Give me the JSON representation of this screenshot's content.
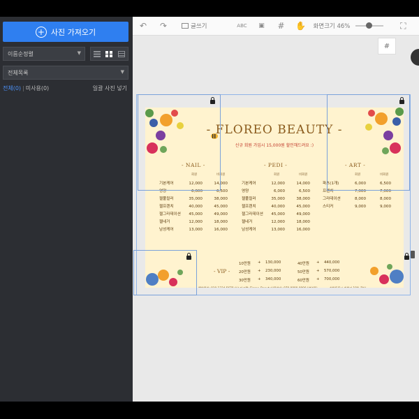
{
  "sidebar": {
    "upload_label": "사진 가져오기",
    "sort_value": "이름순정렬",
    "folder_value": "전체목록",
    "filter_all": "전체(0)",
    "filter_used": "미사용(0)",
    "place_all": "일괄 사진 넣기"
  },
  "toolbar": {
    "write_label": "글쓰기",
    "zoom_label": "화면크기 46%",
    "zoom_value": 0.46
  },
  "card": {
    "title": "- FLOREO BEAUTY -",
    "subtitle": "신규 회원 가입시 15,000원 할인해드려요 :)",
    "sections": [
      {
        "heading": "- NAIL -",
        "col1": "회원",
        "col2": "비회원",
        "rows": [
          {
            "name": "기본케어",
            "v1": "12,000",
            "v2": "14,000"
          },
          {
            "name": "영양",
            "v1": "6,000",
            "v2": "6,500"
          },
          {
            "name": "젤풀컬러",
            "v1": "35,000",
            "v2": "38,000"
          },
          {
            "name": "젤프렌치",
            "v1": "40,000",
            "v2": "45,000"
          },
          {
            "name": "젤그라데이션",
            "v1": "45,000",
            "v2": "49,000"
          },
          {
            "name": "젤네거",
            "v1": "12,000",
            "v2": "18,000"
          },
          {
            "name": "남성케어",
            "v1": "13,000",
            "v2": "16,000"
          }
        ]
      },
      {
        "heading": "- PEDI -",
        "col1": "회원",
        "col2": "비회원",
        "rows": [
          {
            "name": "기본케어",
            "v1": "12,000",
            "v2": "14,000"
          },
          {
            "name": "영양",
            "v1": "6,000",
            "v2": "6,500"
          },
          {
            "name": "젤풀컬러",
            "v1": "35,000",
            "v2": "38,000"
          },
          {
            "name": "젤프렌치",
            "v1": "40,000",
            "v2": "45,000"
          },
          {
            "name": "젤그라데이션",
            "v1": "45,000",
            "v2": "49,000"
          },
          {
            "name": "젤네거",
            "v1": "12,000",
            "v2": "18,000"
          },
          {
            "name": "남성케어",
            "v1": "13,000",
            "v2": "16,000"
          }
        ]
      },
      {
        "heading": "- ART -",
        "col1": "회원",
        "col2": "비회원",
        "rows": [
          {
            "name": "파츠(1개)",
            "v1": "6,000",
            "v2": "6,500"
          },
          {
            "name": "프렌치",
            "v1": "7,000",
            "v2": "7,000"
          },
          {
            "name": "그라데이션",
            "v1": "8,000",
            "v2": "8,000"
          },
          {
            "name": "스티커",
            "v1": "9,000",
            "v2": "9,000"
          }
        ]
      }
    ],
    "vip": {
      "heading": "- VIP -",
      "marker": "+",
      "left": [
        {
          "tier": "10만원",
          "value": "130,000"
        },
        {
          "tier": "20만원",
          "value": "230,000"
        },
        {
          "tier": "30만원",
          "value": "340,000"
        }
      ],
      "right": [
        {
          "tier": "40만원",
          "value": "440,000"
        },
        {
          "tier": "50만원",
          "value": "570,000"
        },
        {
          "tier": "60만원",
          "value": "700,000"
        }
      ]
    },
    "footer": [
      "예약문의: 010-1234-5678",
      "인스타그램: Floreo_Beauty",
      "이용안내: 070-0000-0000 (영업중)",
      "회원등록시 회원가 10% 할인"
    ]
  },
  "colors": {
    "accent": "#2f7ff0",
    "sidebar_bg": "#2c2e33",
    "card_bg": "#fff3cf",
    "title": "#8a5a1c",
    "selection": "#7aa1da"
  },
  "icons": [
    "plus-circle-icon",
    "undo-icon",
    "redo-icon",
    "text-box-icon",
    "abc-icon",
    "image-icon",
    "grid-icon",
    "hand-icon",
    "fit-screen-icon",
    "hash-icon",
    "lock-icon",
    "list-view-icon",
    "grid-view-icon",
    "rows-view-icon",
    "chevron-down-icon"
  ]
}
